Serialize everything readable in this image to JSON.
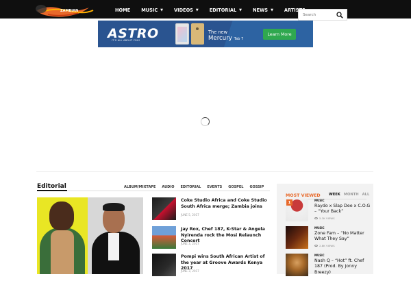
{
  "header": {
    "logo_label": "site-logo",
    "nav": [
      {
        "label": "HOME",
        "dropdown": false
      },
      {
        "label": "MUSIC",
        "dropdown": true
      },
      {
        "label": "VIDEOS",
        "dropdown": true
      },
      {
        "label": "EDITORIAL",
        "dropdown": true
      },
      {
        "label": "NEWS",
        "dropdown": true
      },
      {
        "label": "ARTISTS",
        "dropdown": false
      }
    ],
    "search": {
      "placeholder": "Search",
      "icon": "search-icon"
    }
  },
  "banner_ad": {
    "brand": "ASTRO",
    "brand_tagline": "IT'S ALL ABOUT YOU!",
    "line1": "The new",
    "product": "Mercury",
    "product_suffix": "Tab 7",
    "cta": "Learn More"
  },
  "editorial": {
    "title": "Editorial",
    "filters": [
      "ALBUM/MIXTAPE",
      "AUDIO",
      "EDITORIAL",
      "EVENTS",
      "GOSPEL",
      "GOSSIP"
    ],
    "articles": [
      {
        "title": "Coke Studio Africa and Coke Studio South Africa merge; Zambia joins",
        "date": "JUNE 5, 2017"
      },
      {
        "title": "Jay Rox, Chef 187, K-Star & Angela Nyirenda rock the Mosi Relaunch Concert",
        "date": "JUNE 3, 2017"
      },
      {
        "title": "Pompi wins South African Artist of the year at Groove Awards Kenya 2017",
        "date": "JUNE 3, 2017"
      }
    ]
  },
  "most_viewed": {
    "title": "MOST VIEWED",
    "tabs": [
      {
        "label": "WEEK",
        "active": true
      },
      {
        "label": "MONTH",
        "active": false
      },
      {
        "label": "ALL",
        "active": false
      }
    ],
    "items": [
      {
        "rank": "1",
        "category": "MUSIC",
        "title": "Raydo x Slap Dee x C.O.G – “Your Back”",
        "views": "5.3K VIEWS"
      },
      {
        "rank": "",
        "category": "MUSIC",
        "title": "Zone Fam – “No Matter What They Say”",
        "views": "2.8K VIEWS"
      },
      {
        "rank": "",
        "category": "MUSIC",
        "title": "Nash Q – “Hot” ft. Chef 187 (Prod. By Jonny Breezy)",
        "views": ""
      }
    ]
  },
  "colors": {
    "topbar": "#0f0f0f",
    "accent": "#e8692a",
    "ad_blue": "#2a5490",
    "ad_button": "#2fa84f"
  }
}
